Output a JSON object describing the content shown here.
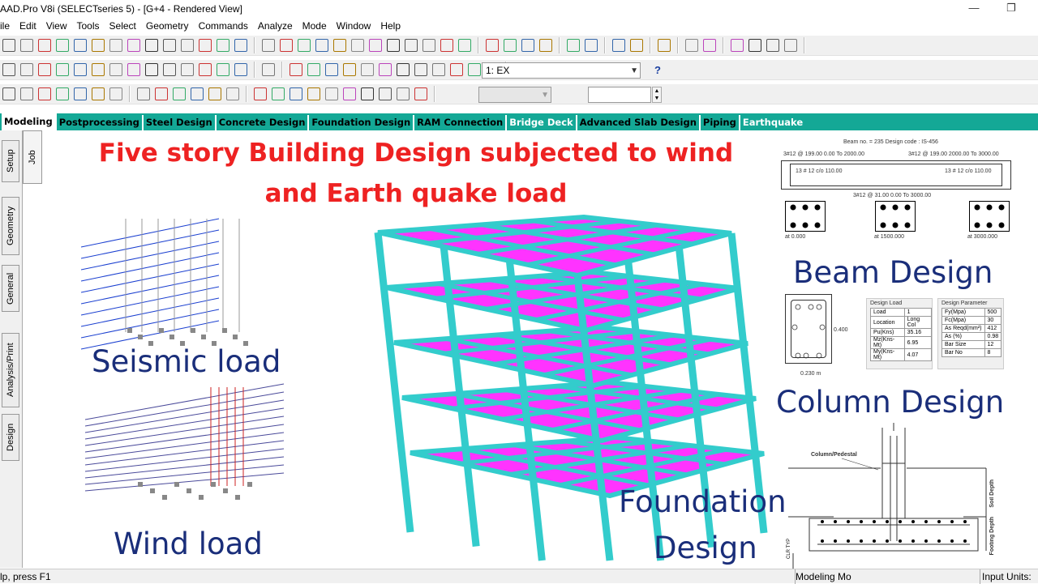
{
  "window": {
    "title": "AAD.Pro V8i (SELECTseries 5) - [G+4 - Rendered View]"
  },
  "menu": [
    "ile",
    "Edit",
    "View",
    "Tools",
    "Select",
    "Geometry",
    "Commands",
    "Analyze",
    "Mode",
    "Window",
    "Help"
  ],
  "toolbar": {
    "load_combo": "1: EX",
    "help_icon": "?"
  },
  "page_tabs": [
    {
      "label": "Modeling",
      "active": true
    },
    {
      "label": "Postprocessing"
    },
    {
      "label": "Steel Design"
    },
    {
      "label": "Concrete Design"
    },
    {
      "label": "Foundation Design"
    },
    {
      "label": "RAM Connection"
    },
    {
      "label": "Bridge Deck"
    },
    {
      "label": "Advanced Slab Design"
    },
    {
      "label": "Piping"
    },
    {
      "label": "Earthquake"
    }
  ],
  "side_tabs": [
    "Setup",
    "Geometry",
    "General",
    "Analysis/Print",
    "Design"
  ],
  "job_tab": "Job",
  "overlay": {
    "title_line1": "Five story Building Design subjected to wind",
    "title_line2": "and Earth quake load",
    "seismic": "Seismic load",
    "wind": "Wind load",
    "foundation1": "Foundation",
    "foundation2": "Design",
    "beam": "Beam Design",
    "column": "Column Design"
  },
  "beam_detail": {
    "header": "Beam no. = 235  Design code : IS-456",
    "top_left": "3#12 @ 199.00 0.00 To 2000.00",
    "top_right": "3#12 @ 199.00 2000.00 To 3000.00",
    "stirrup_left": "13 # 12 c/o 110.00",
    "stirrup_right": "13 # 12 c/o 110.00",
    "bottom": "3#12 @ 31.00 0.00 To 3000.00",
    "sec1": "at 0.000",
    "sec2": "at 1500.000",
    "sec3": "at 3000.000"
  },
  "column_detail": {
    "dim_side": "0.400",
    "dim_bottom": "0.230 m",
    "load_title": "Design Load",
    "load_rows": [
      [
        "Load",
        "1"
      ],
      [
        "Location",
        "Long Col"
      ],
      [
        "Pu(Kns)",
        "35.16"
      ],
      [
        "Mz(Kns-Mt)",
        "6.95"
      ],
      [
        "My(Kns-Mt)",
        "4.07"
      ]
    ],
    "param_title": "Design Parameter",
    "param_rows": [
      [
        "Fy(Mpa)",
        "500"
      ],
      [
        "Fc(Mpa)",
        "30"
      ],
      [
        "As Reqd(mm²)",
        "412"
      ],
      [
        "As (%)",
        "0.98"
      ],
      [
        "Bar Size",
        "12"
      ],
      [
        "Bar No",
        "8"
      ]
    ]
  },
  "footing_detail": {
    "label": "Column/Pedestal",
    "soil": "Soil Depth",
    "footing": "Footing Depth",
    "clr": "CLR TYP"
  },
  "status": {
    "left": "lp, press F1",
    "mode": "Modeling Mo",
    "units": "Input Units:"
  },
  "colors": {
    "slab": "#ff33ff",
    "frame": "#33cccc",
    "tabbar": "#14a896",
    "title_red": "#ee2222",
    "label_blue": "#1a2e7a"
  }
}
